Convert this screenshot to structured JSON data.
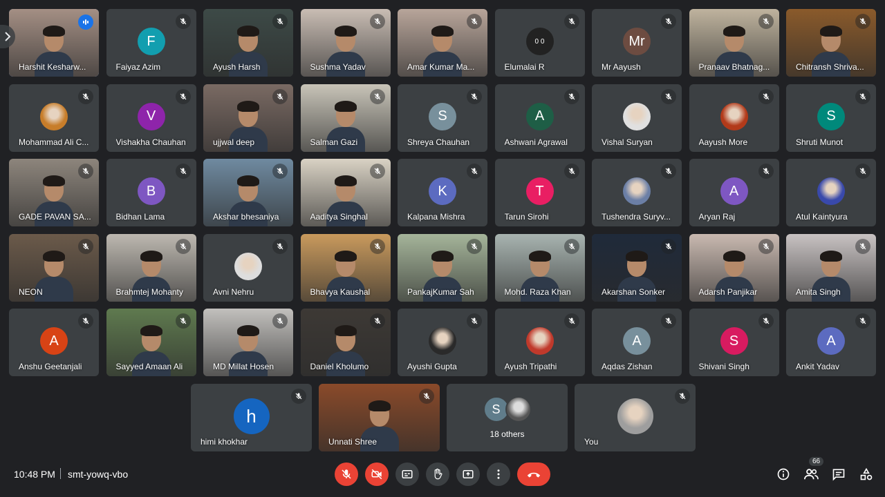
{
  "participants": [
    {
      "name": "Harshit Kesharw...",
      "type": "video",
      "bg": "#a48f84",
      "speaking": true
    },
    {
      "name": "Faiyaz Azim",
      "type": "avatar",
      "initial": "F",
      "color": "#129eaf"
    },
    {
      "name": "Ayush Harsh",
      "type": "video",
      "bg": "#3d4a47"
    },
    {
      "name": "Sushma Yadav",
      "type": "video",
      "bg": "#c9bdb4"
    },
    {
      "name": "Amar Kumar Ma...",
      "type": "video",
      "bg": "#b8a59a"
    },
    {
      "name": "Elumalai R",
      "type": "pic",
      "picText": "0 0",
      "picBg": "#222"
    },
    {
      "name": "Mr Aayush",
      "type": "avatar",
      "initial": "Mr",
      "color": "#6d4c41"
    },
    {
      "name": "Pranaav Bhatnag...",
      "type": "video",
      "bg": "#bfb39e"
    },
    {
      "name": "Chitransh Shriva...",
      "type": "video",
      "bg": "#8a5a2b"
    },
    {
      "name": "Mohammad Ali C...",
      "type": "pic",
      "picBg": "#c77d2a"
    },
    {
      "name": "Vishakha Chauhan",
      "type": "avatar",
      "initial": "V",
      "color": "#8e24aa"
    },
    {
      "name": "ujjwal deep",
      "type": "video",
      "bg": "#7a6a63"
    },
    {
      "name": "Salman Gazi",
      "type": "video",
      "bg": "#c8c4b8"
    },
    {
      "name": "Shreya Chauhan",
      "type": "avatar",
      "initial": "S",
      "color": "#78909c"
    },
    {
      "name": "Ashwani Agrawal",
      "type": "avatar",
      "initial": "A",
      "color": "#1e5e46"
    },
    {
      "name": "Vishal Suryan",
      "type": "pic",
      "picBg": "#e0e0e0"
    },
    {
      "name": "Aayush More",
      "type": "pic",
      "picBg": "#b23a1a"
    },
    {
      "name": "Shruti Munot",
      "type": "avatar",
      "initial": "S",
      "color": "#00897b"
    },
    {
      "name": "GADE PAVAN SA...",
      "type": "video",
      "bg": "#8d857c"
    },
    {
      "name": "Bidhan Lama",
      "type": "avatar",
      "initial": "B",
      "color": "#7e57c2"
    },
    {
      "name": "Akshar bhesaniya",
      "type": "video",
      "bg": "#6f8aa0"
    },
    {
      "name": "Aaditya Singhal",
      "type": "video",
      "bg": "#d9d2c4"
    },
    {
      "name": "Kalpana Mishra",
      "type": "avatar",
      "initial": "K",
      "color": "#5c6bc0"
    },
    {
      "name": "Tarun Sirohi",
      "type": "avatar",
      "initial": "T",
      "color": "#e91e63"
    },
    {
      "name": "Tushendra Suryv...",
      "type": "pic",
      "picBg": "#6b7fa6"
    },
    {
      "name": "Aryan Raj",
      "type": "avatar",
      "initial": "A",
      "color": "#7e57c2"
    },
    {
      "name": "Atul Kaintyura",
      "type": "pic",
      "picBg": "#3949ab"
    },
    {
      "name": "NEON",
      "type": "video",
      "bg": "#6b5a4a"
    },
    {
      "name": "Brahmtej Mohanty",
      "type": "video",
      "bg": "#bdb8b0"
    },
    {
      "name": "Avni Nehru",
      "type": "pic",
      "picBg": "#ddd"
    },
    {
      "name": "Bhavya Kaushal",
      "type": "video",
      "bg": "#c99a5d"
    },
    {
      "name": "PankajKumar Sah",
      "type": "video",
      "bg": "#a5b59a"
    },
    {
      "name": "Mohd. Raza Khan",
      "type": "video",
      "bg": "#a8b4b0"
    },
    {
      "name": "Akarshan Sonker",
      "type": "video",
      "bg": "#1f2a3a"
    },
    {
      "name": "Adarsh Panjikar",
      "type": "video",
      "bg": "#c9b9b0"
    },
    {
      "name": "Amita Singh",
      "type": "video",
      "bg": "#c8c2c2"
    },
    {
      "name": "Anshu Geetanjali",
      "type": "avatar",
      "initial": "A",
      "color": "#d84315"
    },
    {
      "name": "Sayyed Amaan Ali",
      "type": "video",
      "bg": "#5f7a4f"
    },
    {
      "name": "MD Millat Hosen",
      "type": "video",
      "bg": "#c2c0bd"
    },
    {
      "name": "Daniel Kholumo",
      "type": "video",
      "bg": "#3d3935"
    },
    {
      "name": "Ayushi Gupta",
      "type": "pic",
      "picBg": "#2a2a2a"
    },
    {
      "name": "Ayush Tripathi",
      "type": "pic",
      "picBg": "#c0392b"
    },
    {
      "name": "Aqdas Zishan",
      "type": "avatar",
      "initial": "A",
      "color": "#78909c"
    },
    {
      "name": "Shivani Singh",
      "type": "avatar",
      "initial": "S",
      "color": "#d81b60"
    },
    {
      "name": "Ankit Yadav",
      "type": "avatar",
      "initial": "A",
      "color": "#5c6bc0"
    }
  ],
  "bottom_tiles": [
    {
      "name": "himi khokhar",
      "type": "avatar",
      "initial": "h",
      "color": "#1565c0"
    },
    {
      "name": "Unnati Shree",
      "type": "video",
      "bg": "#8a4a2a"
    },
    {
      "name": "18 others",
      "type": "others",
      "initial": "S",
      "color": "#607d8b"
    },
    {
      "name": "You",
      "type": "pic",
      "picBg": "#9e9e9e"
    }
  ],
  "bar": {
    "time": "10:48 PM",
    "meeting_code": "smt-yowq-vbo",
    "people_count": "66"
  },
  "icons": {
    "mic_off": "mic-off-icon",
    "camera_off": "camera-off-icon",
    "captions": "captions-icon",
    "raise_hand": "raise-hand-icon",
    "present": "present-icon",
    "more": "more-vert-icon",
    "leave": "leave-call-icon",
    "info": "info-icon",
    "people": "people-icon",
    "chat": "chat-icon",
    "activities": "activities-icon"
  },
  "colors": {
    "background": "#202124",
    "tile": "#3c4043",
    "leave": "#ea4335",
    "active_border": "#8ab4f8"
  }
}
